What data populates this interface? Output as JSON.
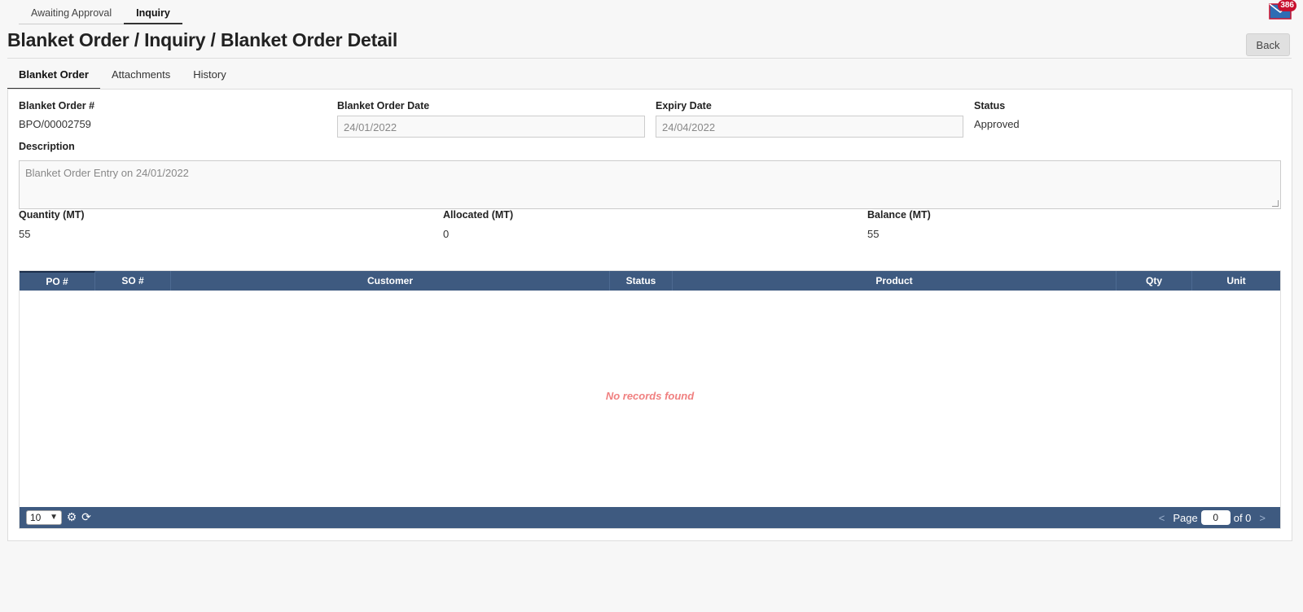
{
  "top_tabs": [
    "Awaiting Approval",
    "Inquiry"
  ],
  "mail": {
    "badge": "386"
  },
  "page_title": "Blanket Order / Inquiry / Blanket Order Detail",
  "back_label": "Back",
  "detail_tabs": [
    "Blanket Order",
    "Attachments",
    "History"
  ],
  "form": {
    "bo_number_label": "Blanket Order #",
    "bo_number_value": "BPO/00002759",
    "bo_date_label": "Blanket Order Date",
    "bo_date_value": "24/01/2022",
    "expiry_label": "Expiry Date",
    "expiry_value": "24/04/2022",
    "status_label": "Status",
    "status_value": "Approved",
    "description_label": "Description",
    "description_value": "Blanket Order Entry on 24/01/2022",
    "quantity_label": "Quantity (MT)",
    "quantity_value": "55",
    "allocated_label": "Allocated (MT)",
    "allocated_value": "0",
    "balance_label": "Balance (MT)",
    "balance_value": "55"
  },
  "grid": {
    "columns": [
      "PO #",
      "SO #",
      "Customer",
      "Status",
      "Product",
      "Qty",
      "Unit"
    ],
    "empty_message": "No records found",
    "page_size": "10",
    "page_label": "Page",
    "page_value": "0",
    "of_label": "of 0",
    "prev": "<",
    "next": ">"
  }
}
